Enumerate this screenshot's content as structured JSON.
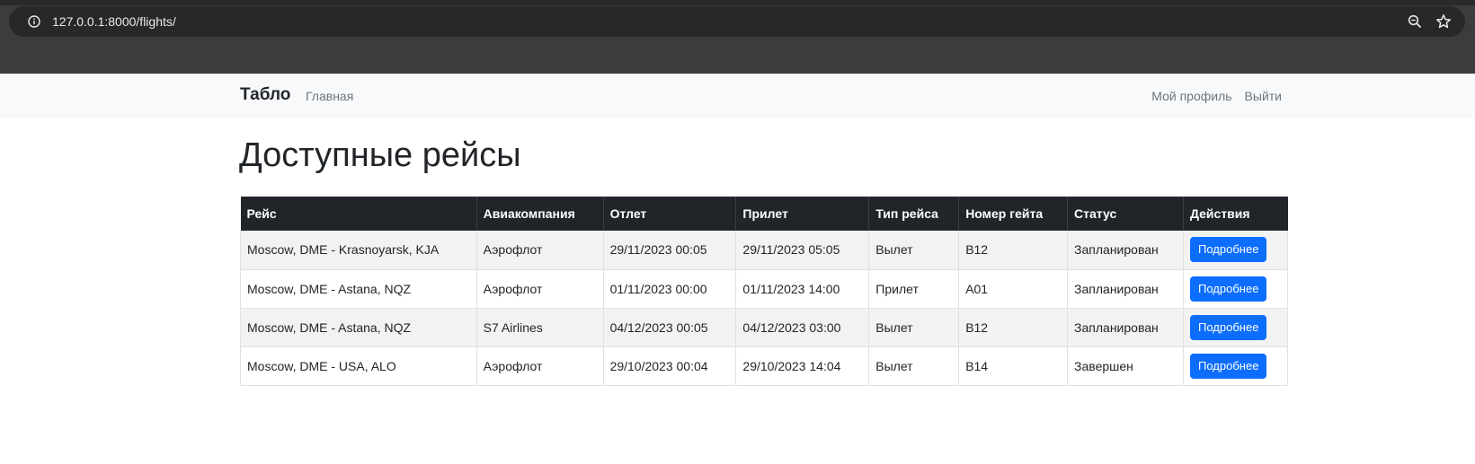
{
  "browser": {
    "url": "127.0.0.1:8000/flights/",
    "icons": [
      "info-icon",
      "zoom-icon",
      "star-icon"
    ]
  },
  "navbar": {
    "brand": "Табло",
    "home": "Главная",
    "profile": "Мой профиль",
    "logout": "Выйти"
  },
  "page": {
    "title": "Доступные рейсы"
  },
  "table": {
    "headers": [
      "Рейс",
      "Авиакомпания",
      "Отлет",
      "Прилет",
      "Тип рейса",
      "Номер гейта",
      "Статус",
      "Действия"
    ],
    "rows": [
      {
        "flight": "Moscow, DME - Krasnoyarsk, KJA",
        "airline": "Аэрофлот",
        "departure": "29/11/2023 00:05",
        "arrival": "29/11/2023 05:05",
        "type": "Вылет",
        "gate": "B12",
        "status": "Запланирован",
        "action": "Подробнее"
      },
      {
        "flight": "Moscow, DME - Astana, NQZ",
        "airline": "Аэрофлот",
        "departure": "01/11/2023 00:00",
        "arrival": "01/11/2023 14:00",
        "type": "Прилет",
        "gate": "A01",
        "status": "Запланирован",
        "action": "Подробнее"
      },
      {
        "flight": "Moscow, DME - Astana, NQZ",
        "airline": "S7 Airlines",
        "departure": "04/12/2023 00:05",
        "arrival": "04/12/2023 03:00",
        "type": "Вылет",
        "gate": "B12",
        "status": "Запланирован",
        "action": "Подробнее"
      },
      {
        "flight": "Moscow, DME - USA, ALO",
        "airline": "Аэрофлот",
        "departure": "29/10/2023 00:04",
        "arrival": "29/10/2023 14:04",
        "type": "Вылет",
        "gate": "B14",
        "status": "Завершен",
        "action": "Подробнее"
      }
    ]
  },
  "colors": {
    "accent": "#0d6efd",
    "table_header": "#212529",
    "navbar_bg": "#f8f9fa"
  }
}
